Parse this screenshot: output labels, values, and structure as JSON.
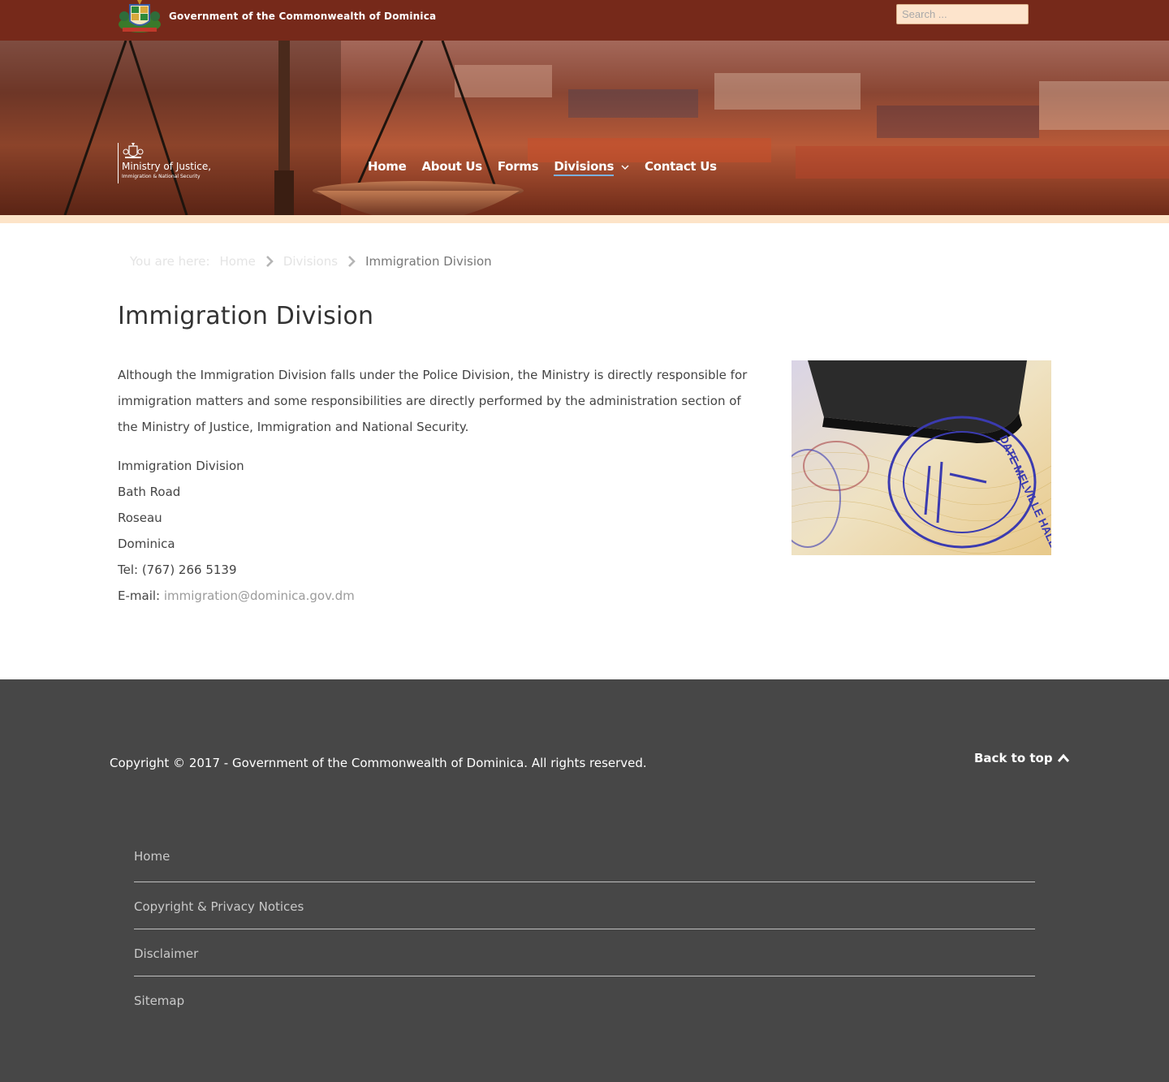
{
  "topbar": {
    "gov_title": "Government of the Commonwealth of Dominica",
    "search_placeholder": "Search ..."
  },
  "header": {
    "ministry_name": "Ministry of Justice,",
    "ministry_sub": "Immigration & National Security",
    "nav": [
      {
        "label": "Home"
      },
      {
        "label": "About Us"
      },
      {
        "label": "Forms"
      },
      {
        "label": "Divisions",
        "has_dropdown": true,
        "active": true
      },
      {
        "label": "Contact Us"
      }
    ]
  },
  "breadcrumb": {
    "prefix": "You are here:",
    "items": [
      "Home",
      "Divisions"
    ],
    "current": "Immigration Division"
  },
  "main": {
    "title": "Immigration Division",
    "intro": "Although the Immigration Division falls under the Police Division, the Ministry is directly responsible for immigration matters and some responsibilities are directly performed by the administration section of the Ministry of Justice, Immigration and National Security.",
    "address": {
      "line1": "Immigration Division",
      "line2": "Bath Road",
      "line3": "Roseau",
      "line4": "Dominica",
      "tel": "Tel: (767) 266 5139",
      "email_label": "E-mail: ",
      "email": "immigration@dominica.gov.dm"
    },
    "image_stamp_text": "DATE   MELVILLE HALL"
  },
  "footer": {
    "copyright": "Copyright © 2017 - Government of the Commonwealth of Dominica. All rights reserved.",
    "back_to_top": "Back to top",
    "links": [
      "Home",
      "Copyright & Privacy Notices",
      "Disclaimer",
      "Sitemap"
    ]
  },
  "colors": {
    "topbar_bg": "#76291a",
    "search_bg": "#fde4cc",
    "hero_strip": "#fde4c8",
    "footer_bg": "#474747",
    "nav_active_underline": "#7bb0dc",
    "link_gray": "#9b9b9b"
  }
}
